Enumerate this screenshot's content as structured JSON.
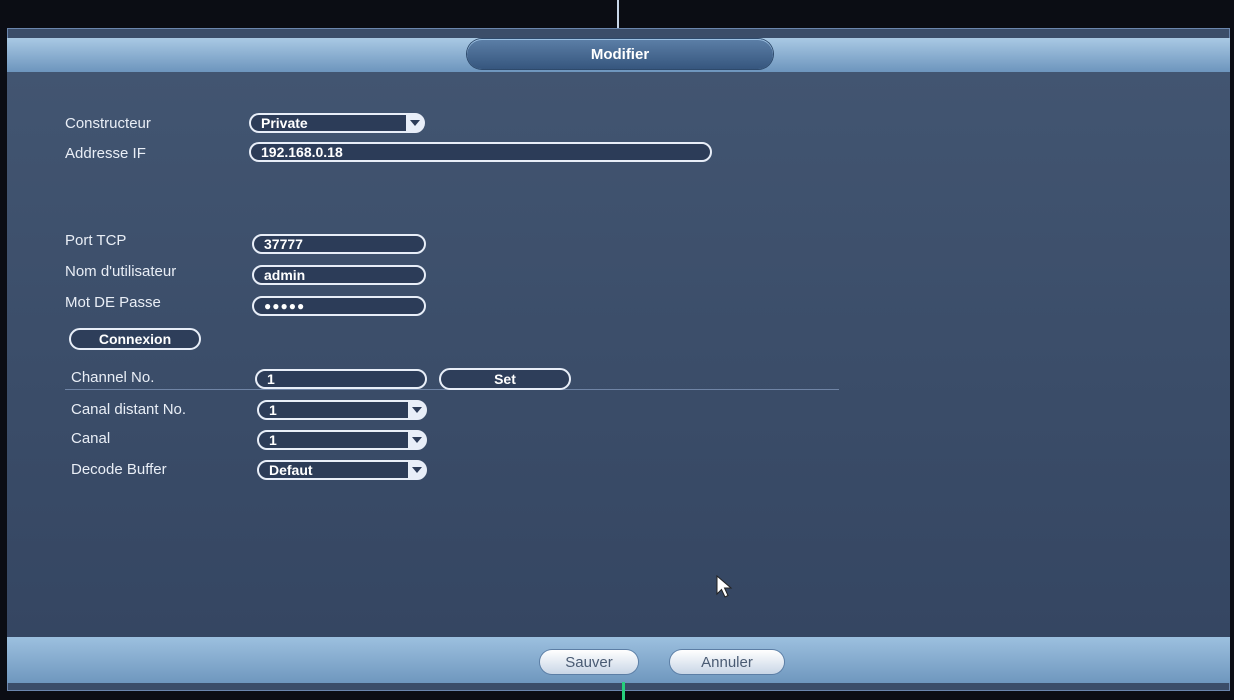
{
  "dialog": {
    "title": "Modifier"
  },
  "form": {
    "manufacturer": {
      "label": "Constructeur",
      "value": "Private"
    },
    "ip": {
      "label": "Addresse IF",
      "value": "192.168.0.18"
    },
    "tcp_port": {
      "label": "Port TCP",
      "value": "37777"
    },
    "username": {
      "label": "Nom d'utilisateur",
      "value": "admin"
    },
    "password": {
      "label": "Mot DE Passe",
      "value": "●●●●●"
    },
    "connect_button": "Connexion",
    "channel_no": {
      "label": "Channel No.",
      "value": "1"
    },
    "set_button": "Set",
    "remote_channel": {
      "label": "Canal distant No.",
      "value": "1"
    },
    "channel": {
      "label": "Canal",
      "value": "1"
    },
    "decode_buffer": {
      "label": "Decode Buffer",
      "value": "Defaut"
    }
  },
  "footer": {
    "save_label": "Sauver",
    "cancel_label": "Annuler"
  },
  "icons": {
    "dropdown": "chevron-down-icon",
    "cursor": "mouse-pointer-icon"
  }
}
